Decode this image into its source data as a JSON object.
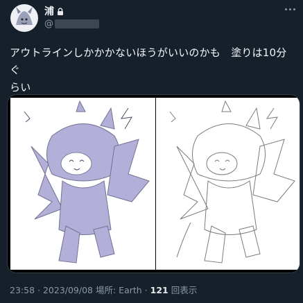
{
  "author": {
    "display_name": "浦",
    "handle_prefix": "@"
  },
  "tweet": {
    "text_line1": "アウトラインしかかかないほうがいいのかも　塗りは10分ぐ",
    "text_line2": "らい"
  },
  "media": {
    "images": [
      {
        "name": "colored-sketch",
        "variant": "colored"
      },
      {
        "name": "outline-sketch",
        "variant": "outline"
      }
    ]
  },
  "meta": {
    "time": "23:58",
    "sep1": " · ",
    "date": "2023/09/08",
    "location_label": " 場所: ",
    "location": "Earth",
    "sep2": " · ",
    "views_count": "121",
    "views_label": " 回表示"
  },
  "colors": {
    "background": "#15202b",
    "text": "#e7e9ea",
    "muted": "#8b98a5",
    "sketch_fill": "#a9a7d4"
  }
}
